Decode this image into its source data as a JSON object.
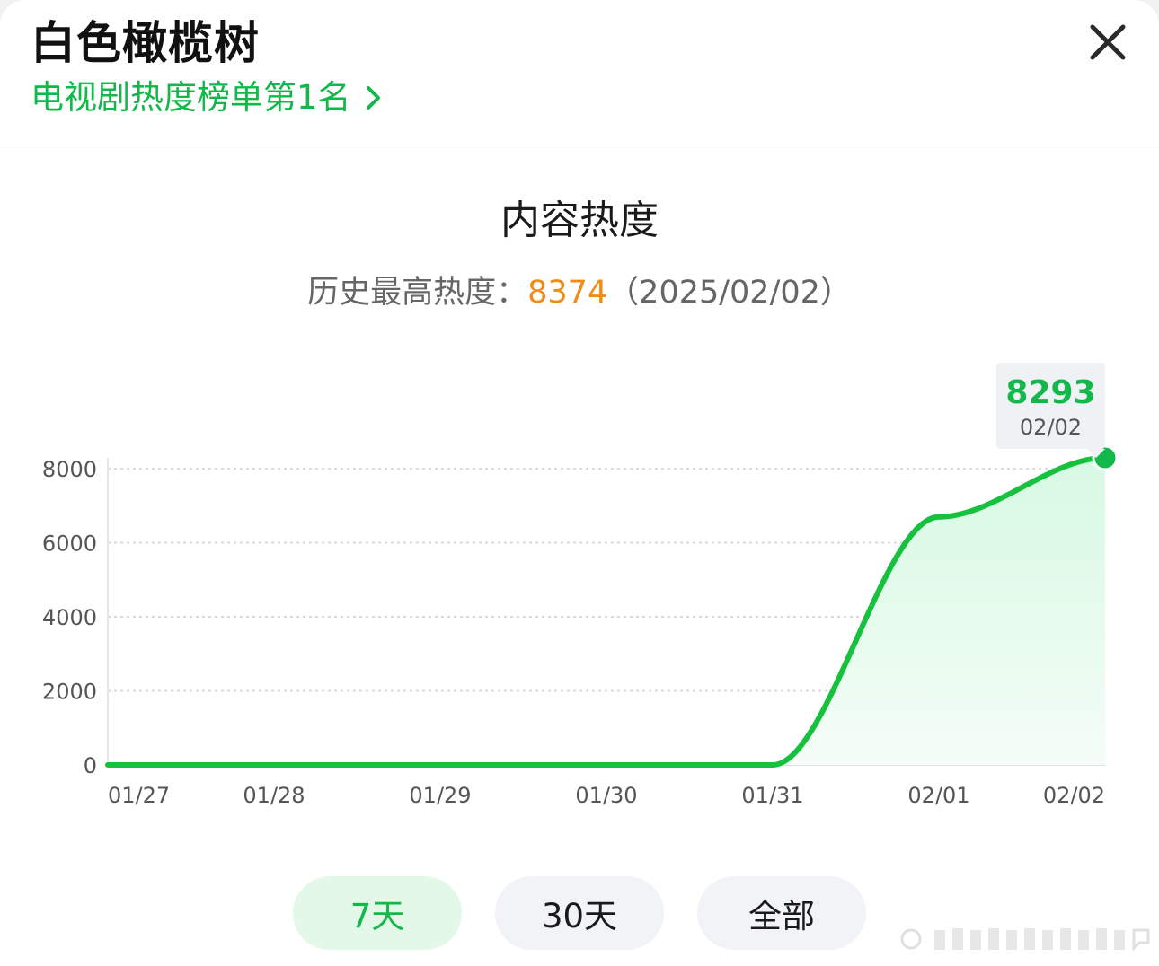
{
  "colors": {
    "accent": "#12b84a",
    "peak": "#f08c1a",
    "line": "#16c13e",
    "fill": "#d7f9e3",
    "grid": "#d8d8d8",
    "axis_text": "#555555"
  },
  "header": {
    "title": "白色橄榄树",
    "rank_text": "电视剧热度榜单第1名",
    "rank_icon": "chevron-right-icon",
    "close_icon": "close-icon"
  },
  "chart_header": {
    "title": "内容热度",
    "peak_label": "历史最高热度：",
    "peak_value": "8374",
    "peak_date": "（2025/02/02）"
  },
  "tooltip": {
    "value": "8293",
    "date": "02/02"
  },
  "range_tabs": [
    {
      "label": "7天",
      "active": true
    },
    {
      "label": "30天",
      "active": false
    },
    {
      "label": "全部",
      "active": false
    }
  ],
  "chart_data": {
    "type": "area",
    "x": [
      "01/27",
      "01/28",
      "01/29",
      "01/30",
      "01/31",
      "02/01",
      "02/02"
    ],
    "series": [
      {
        "values": [
          0,
          0,
          0,
          0,
          0,
          6700,
          8293
        ]
      }
    ],
    "y_ticks": [
      0,
      2000,
      4000,
      6000,
      8000
    ],
    "ylim": [
      0,
      8293
    ],
    "grid": true,
    "highlight_point": {
      "x": "02/02",
      "y": 8293
    }
  }
}
